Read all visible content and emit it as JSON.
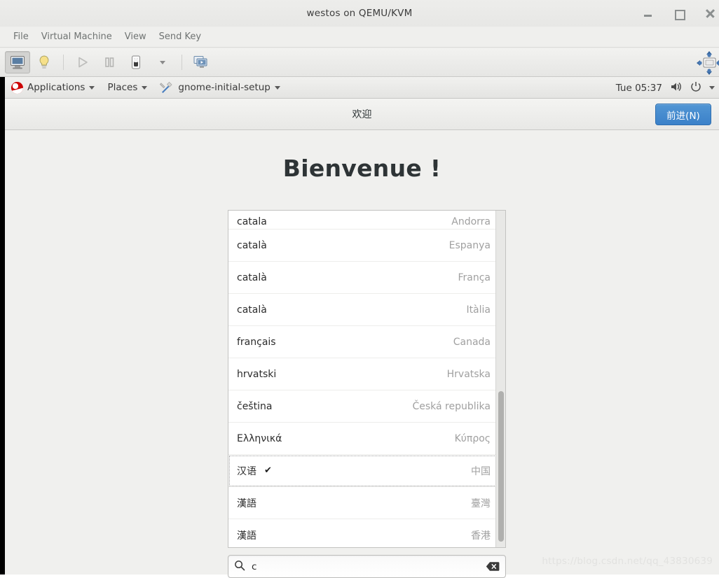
{
  "window": {
    "title": "westos on QEMU/KVM",
    "controls": [
      {
        "name": "minimize",
        "label": "_"
      },
      {
        "name": "maximize",
        "label": "□"
      },
      {
        "name": "close",
        "label": "×"
      }
    ],
    "menus": [
      "File",
      "Virtual Machine",
      "View",
      "Send Key"
    ],
    "toolbar_icons": [
      "console-monitor-icon",
      "details-lightbulb-icon",
      "run-play-icon",
      "pause-icon",
      "shutdown-power-icon",
      "shutdown-dropdown-arrow-icon",
      "snapshots-icon",
      "fullscreen-icon"
    ]
  },
  "gnome_panel": {
    "logo": "redhat-logo-icon",
    "applications": "Applications",
    "places": "Places",
    "app_window": "gnome-initial-setup",
    "app_icon": "tools-icon",
    "clock": "Tue 05:37",
    "volume_icon": "volume-icon",
    "power_icon": "power-icon"
  },
  "setup": {
    "header_title": "欢迎",
    "next_button": "前进(N)",
    "welcome_title": "Bienvenue !",
    "accent_color": "#3b81c9"
  },
  "language_list": [
    {
      "language": "catala",
      "country": "Andorra",
      "selected": false,
      "clipped": true
    },
    {
      "language": "català",
      "country": "Espanya",
      "selected": false,
      "clipped": false
    },
    {
      "language": "català",
      "country": "França",
      "selected": false,
      "clipped": false
    },
    {
      "language": "català",
      "country": "Itàlia",
      "selected": false,
      "clipped": false
    },
    {
      "language": "français",
      "country": "Canada",
      "selected": false,
      "clipped": false
    },
    {
      "language": "hrvatski",
      "country": "Hrvatska",
      "selected": false,
      "clipped": false
    },
    {
      "language": "čeština",
      "country": "Česká republika",
      "selected": false,
      "clipped": false
    },
    {
      "language": "Ελληνικά",
      "country": "Κύπρος",
      "selected": false,
      "clipped": false
    },
    {
      "language": "汉语",
      "country": "中国",
      "selected": true,
      "clipped": false
    },
    {
      "language": "漢語",
      "country": "臺灣",
      "selected": false,
      "clipped": false
    },
    {
      "language": "漢語",
      "country": "香港",
      "selected": false,
      "clipped": false
    }
  ],
  "selected_check": "✔",
  "search": {
    "icon": "search-icon",
    "value": "c",
    "placeholder": "",
    "clear_icon": "clear-backspace-icon"
  },
  "watermark": "https://blog.csdn.net/qq_43830639"
}
